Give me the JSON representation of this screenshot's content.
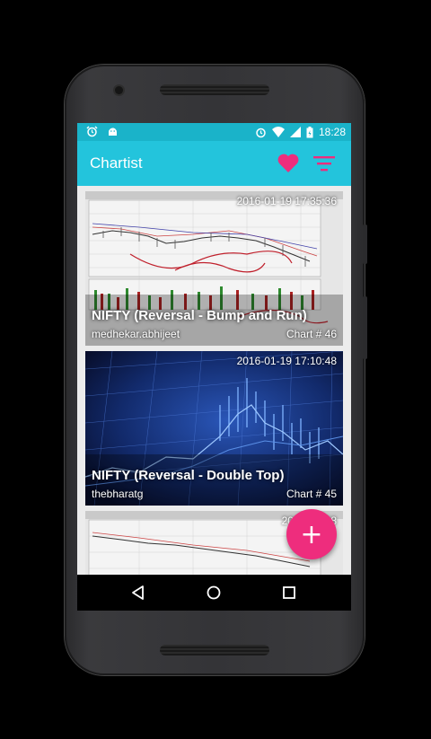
{
  "status_bar": {
    "time": "18:28",
    "left_icons": [
      "alarm-icon",
      "android-icon"
    ],
    "right_icons": [
      "alarm-icon",
      "wifi-icon",
      "signal-icon",
      "battery-icon"
    ]
  },
  "toolbar": {
    "title": "Chartist",
    "actions": [
      "heart-icon",
      "filter-icon"
    ]
  },
  "cards": [
    {
      "timestamp": "2016-01-19 17:35:36",
      "title": "NIFTY (Reversal - Bump and Run)",
      "author": "medhekar.abhijeet",
      "chart_number": "Chart # 46"
    },
    {
      "timestamp": "2016-01-19 17:10:48",
      "title": "NIFTY (Reversal - Double Top)",
      "author": "thebharatg",
      "chart_number": "Chart # 45"
    },
    {
      "timestamp": "2016-01-18",
      "title": "",
      "author": "",
      "chart_number": ""
    }
  ],
  "fab": {
    "label": "+"
  },
  "nav_bar": [
    "back-icon",
    "home-icon",
    "recents-icon"
  ],
  "colors": {
    "status_bar": "#1ab3c9",
    "toolbar": "#23c4dc",
    "accent": "#ee2d7d"
  }
}
